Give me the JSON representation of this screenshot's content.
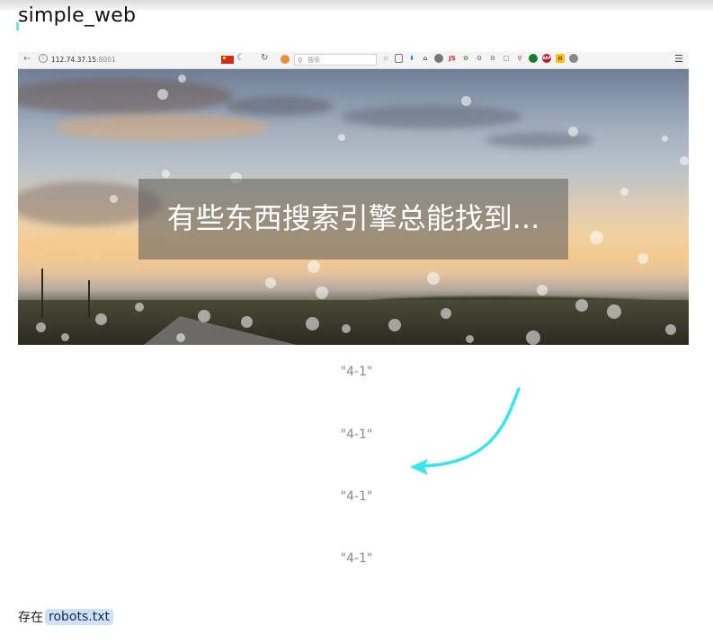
{
  "page": {
    "title": "simple_web"
  },
  "screenshot": {
    "browser": {
      "url_host": "112.74.37.15",
      "url_port": ":8001",
      "search_placeholder": "搜索",
      "js_badge": "JS",
      "abp_badge": "ABP"
    },
    "hero_text": "有些东西搜索引擎总能找到..."
  },
  "quotes": [
    "\"4-1\"",
    "\"4-1\"",
    "\"4-1\"",
    "\"4-1\""
  ],
  "footer": {
    "prefix": "存在",
    "code": "robots.txt"
  },
  "colors": {
    "arrow": "#35e6ee",
    "quote_text": "#8a8a8a",
    "code_bg": "#cfe1f7"
  }
}
